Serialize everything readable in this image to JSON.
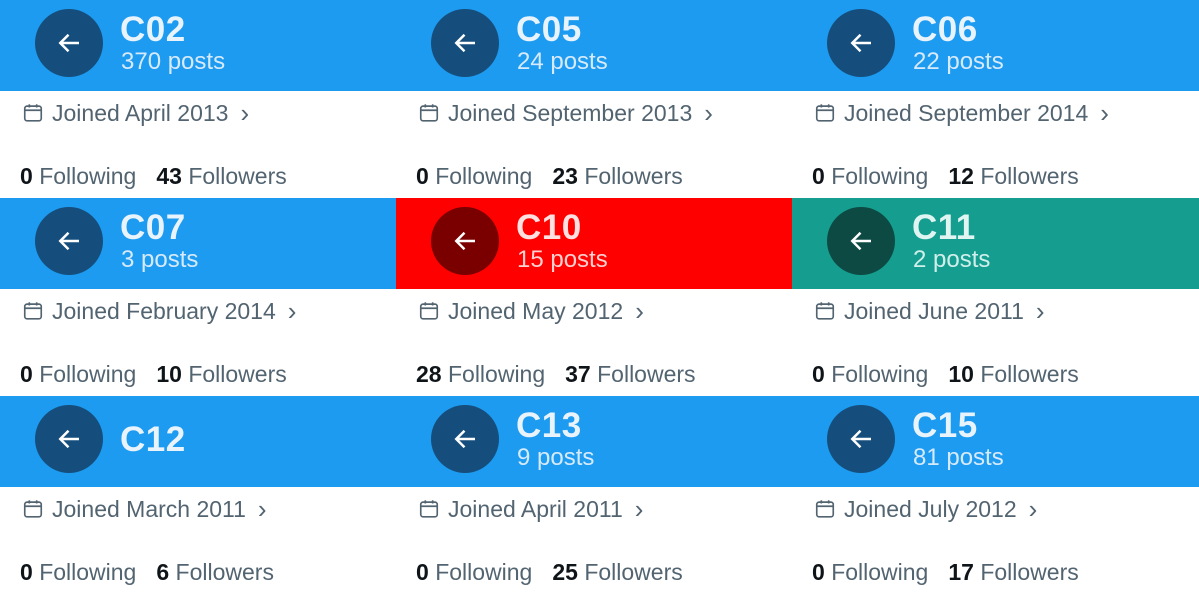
{
  "colors": {
    "blue_header": "#1d9bf0",
    "red_header": "#ff0000",
    "teal_header": "#159e8f",
    "blue_back": "#154e7c",
    "red_back": "#7a0000",
    "teal_back": "#0d4a43"
  },
  "cards": [
    {
      "name": "C02",
      "posts": "370 posts",
      "joined": "Joined April 2013",
      "following": "0",
      "following_label": "Following",
      "followers": "43",
      "followers_label": "Followers"
    },
    {
      "name": "C05",
      "posts": "24 posts",
      "joined": "Joined September 2013",
      "following": "0",
      "following_label": "Following",
      "followers": "23",
      "followers_label": "Followers"
    },
    {
      "name": "C06",
      "posts": "22 posts",
      "joined": "Joined September 2014",
      "following": "0",
      "following_label": "Following",
      "followers": "12",
      "followers_label": "Followers"
    },
    {
      "name": "C07",
      "posts": "3 posts",
      "joined": "Joined February 2014",
      "following": "0",
      "following_label": "Following",
      "followers": "10",
      "followers_label": "Followers"
    },
    {
      "name": "C10",
      "posts": "15 posts",
      "joined": "Joined May 2012",
      "following": "28",
      "following_label": "Following",
      "followers": "37",
      "followers_label": "Followers"
    },
    {
      "name": "C11",
      "posts": "2 posts",
      "joined": "Joined June 2011",
      "following": "0",
      "following_label": "Following",
      "followers": "10",
      "followers_label": "Followers"
    },
    {
      "name": "C12",
      "posts": "",
      "joined": "Joined March 2011",
      "following": "0",
      "following_label": "Following",
      "followers": "6",
      "followers_label": "Followers"
    },
    {
      "name": "C13",
      "posts": "9 posts",
      "joined": "Joined April 2011",
      "following": "0",
      "following_label": "Following",
      "followers": "25",
      "followers_label": "Followers"
    },
    {
      "name": "C15",
      "posts": "81 posts",
      "joined": "Joined July 2012",
      "following": "0",
      "following_label": "Following",
      "followers": "17",
      "followers_label": "Followers"
    }
  ],
  "icons": {
    "back": "arrow-left-icon",
    "calendar": "calendar-icon",
    "chevron": "chevron-right-icon"
  }
}
